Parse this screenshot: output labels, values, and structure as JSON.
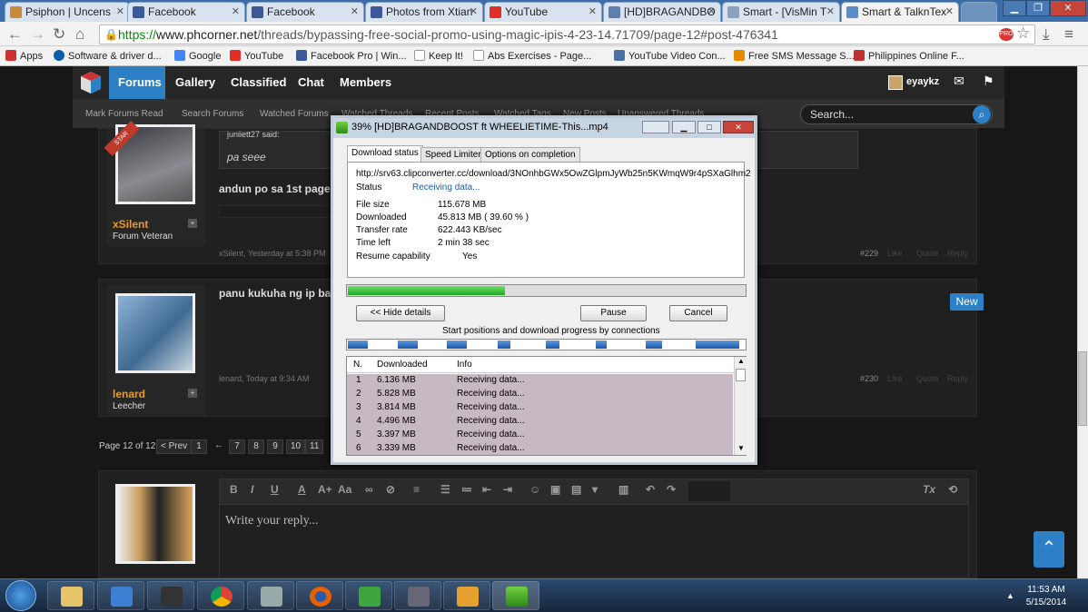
{
  "browser": {
    "tabs": [
      {
        "label": "Psiphon | Uncens",
        "color": "#c98a3a"
      },
      {
        "label": "Facebook",
        "color": "#3b5998"
      },
      {
        "label": "Facebook",
        "color": "#3b5998"
      },
      {
        "label": "Photos from Xtian",
        "color": "#3b5998"
      },
      {
        "label": "YouTube",
        "color": "#e52d27"
      },
      {
        "label": "[HD]BRAGANDBO",
        "color": "#5f7fb0"
      },
      {
        "label": "Smart - [VisMin T",
        "color": "#8aa2c0"
      },
      {
        "label": "Smart & TalknTex",
        "color": "#5d8bc4"
      }
    ],
    "url_prefix": "https://",
    "url_domain": "www.phcorner.net",
    "url_path": "/threads/bypassing-free-social-promo-using-magic-ipis-4-23-14.71709/page-12#post-476341",
    "bookmarks": [
      {
        "label": "Apps",
        "color": "#c33"
      },
      {
        "label": "Software & driver d...",
        "color": "#0a5cad"
      },
      {
        "label": "Google",
        "color": "#4285f4"
      },
      {
        "label": "YouTube",
        "color": "#e52d27"
      },
      {
        "label": "Facebook Pro | Win...",
        "color": "#3b5998"
      },
      {
        "label": "Keep It!",
        "color": "#ccc"
      },
      {
        "label": "Abs Exercises - Page...",
        "color": "#ccc"
      },
      {
        "label": "YouTube Video Con...",
        "color": "#4a6fa5"
      },
      {
        "label": "Free SMS Message S...",
        "color": "#e68a00"
      },
      {
        "label": "Philippines Online F...",
        "color": "#b33"
      }
    ]
  },
  "forum": {
    "nav": [
      "Forums",
      "Gallery",
      "Classified",
      "Chat",
      "Members"
    ],
    "user": "eyaykz",
    "subnav": [
      "Mark Forums Read",
      "Search Forums",
      "Watched Forums",
      "Watched Threads",
      "Recent Posts",
      "Watched Tags",
      "New Posts",
      "Unanswered Threads"
    ],
    "search_placeholder": "Search...",
    "post1": {
      "quote_author": "juniiett27 said:",
      "quote_text": "pa seee",
      "text": "andun po sa 1st page",
      "username": "xSilent",
      "usertitle": "Forum Veteran",
      "meta": "xSilent, Yesterday at 5:38 PM",
      "number": "#229",
      "ribbon": "STAR"
    },
    "post2": {
      "text": "panu kukuha ng ip ba",
      "username": "lenard",
      "usertitle": "Leecher",
      "meta": "lenard, Today at 9:34 AM",
      "number": "#230",
      "badge": "New"
    },
    "actions": [
      "Like",
      "Quote",
      "Reply"
    ],
    "pagination": {
      "label": "Page 12 of 12",
      "prev": "< Prev",
      "pages": [
        "1",
        "←",
        "7",
        "8",
        "9",
        "10",
        "11"
      ]
    },
    "reply_placeholder": "Write your reply..."
  },
  "idm": {
    "title": "39% [HD]BRAGANDBOOST ft WHEELIETIME-This...mp4",
    "tabs": [
      "Download status",
      "Speed Limiter",
      "Options on completion"
    ],
    "url": "http://srv63.clipconverter.cc/download/3NOnhbGWx5OwZGlpmJyWb25n5KWmqW9r4pSXaGlhm2",
    "status_label": "Status",
    "status_value": "Receiving data...",
    "fields": [
      {
        "label": "File size",
        "value": "115.678  MB"
      },
      {
        "label": "Downloaded",
        "value": "45.813  MB  ( 39.60 % )"
      },
      {
        "label": "Transfer rate",
        "value": "622.443  KB/sec"
      },
      {
        "label": "Time left",
        "value": "2 min 38 sec"
      },
      {
        "label": "Resume capability",
        "value": "Yes"
      }
    ],
    "progress_fraction": 0.396,
    "buttons": {
      "hide": "<< Hide details",
      "pause": "Pause",
      "cancel": "Cancel"
    },
    "conn_label": "Start positions and download progress by connections",
    "columns": [
      "N.",
      "Downloaded",
      "Info"
    ],
    "connections": [
      {
        "n": "1",
        "downloaded": "6.136  MB",
        "info": "Receiving data..."
      },
      {
        "n": "2",
        "downloaded": "5.828  MB",
        "info": "Receiving data..."
      },
      {
        "n": "3",
        "downloaded": "3.814  MB",
        "info": "Receiving data..."
      },
      {
        "n": "4",
        "downloaded": "4.496  MB",
        "info": "Receiving data..."
      },
      {
        "n": "5",
        "downloaded": "3.397  MB",
        "info": "Receiving data..."
      },
      {
        "n": "6",
        "downloaded": "3.339  MB",
        "info": "Receiving data..."
      }
    ]
  },
  "taskbar": {
    "time": "11:53 AM",
    "date": "5/15/2014"
  }
}
